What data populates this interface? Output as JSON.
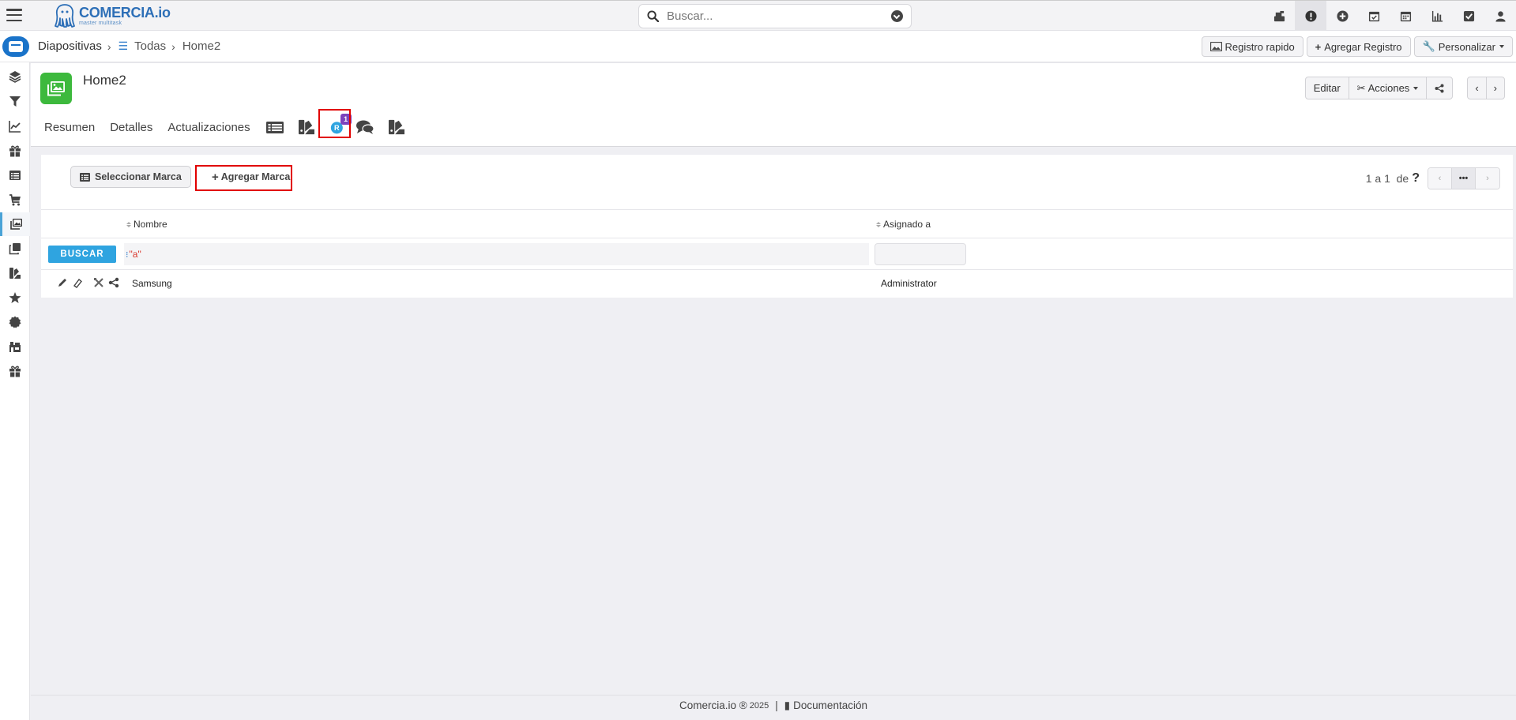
{
  "app": {
    "brand_main": "COMERCIA",
    "brand_ext": ".io",
    "tagline": "master multitask"
  },
  "search": {
    "placeholder": "Buscar..."
  },
  "breadcrumb": {
    "module": "Diapositivas",
    "list": "Todas",
    "record": "Home2"
  },
  "header_actions": {
    "quick_record": "Registro rapido",
    "add_record": "Agregar Registro",
    "customize": "Personalizar"
  },
  "record": {
    "title": "Home2",
    "edit": "Editar",
    "actions": "Acciones",
    "tabs": [
      "Resumen",
      "Detalles",
      "Actualizaciones"
    ],
    "related_badge": "1"
  },
  "related": {
    "select_btn": "Seleccionar Marca",
    "add_btn": "Agregar Marca",
    "pager_text": "1 a 1  de",
    "pager_help": "?",
    "pager_more": "•••",
    "columns": [
      "Nombre",
      "Asignado a"
    ],
    "search_btn": "BUSCAR",
    "filter_icon_text": "a",
    "rows": [
      {
        "name": "Samsung",
        "assigned": "Administrator"
      }
    ]
  },
  "footer": {
    "brand": "Comercia.io ®",
    "year": "2025",
    "separator": "|",
    "docs": "Documentación"
  },
  "colors": {
    "accent": "#2fa4e0",
    "record_icon": "#3db93d",
    "highlight": "#e10000",
    "badge": "#7c43bd"
  }
}
